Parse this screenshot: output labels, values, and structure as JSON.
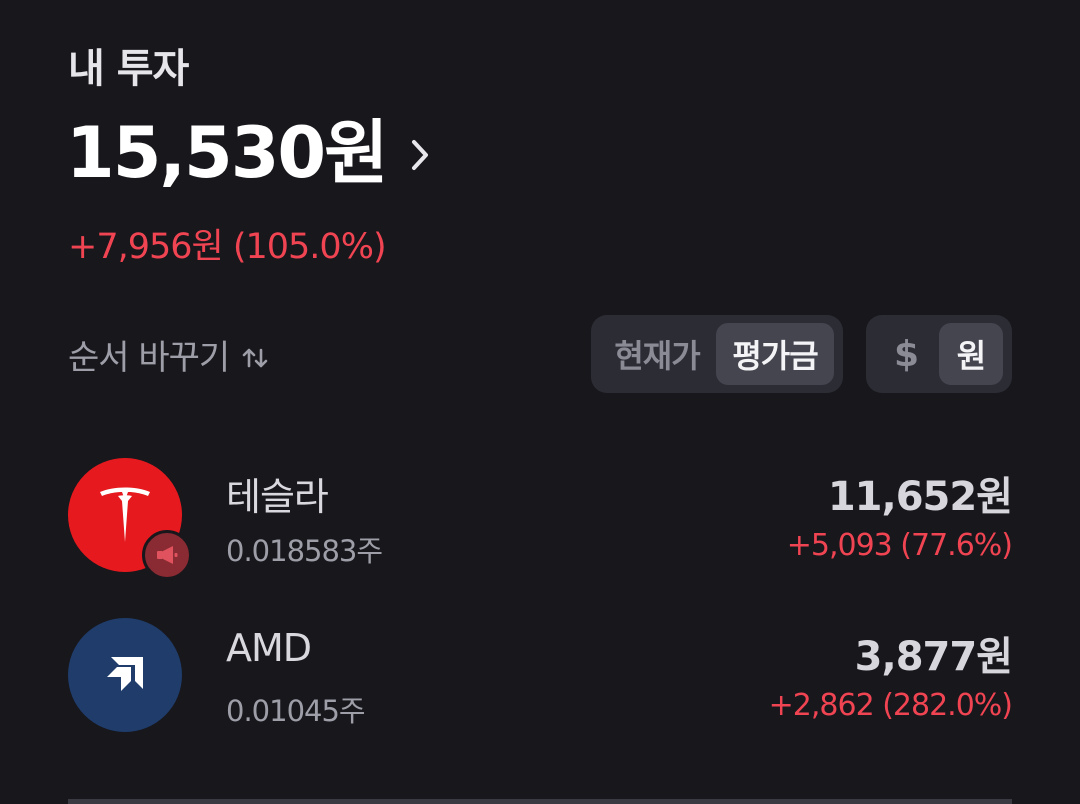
{
  "section": {
    "title": "내 투자"
  },
  "summary": {
    "total_amount": "15,530원",
    "total_change": "+7,956원 (105.0%)"
  },
  "sort": {
    "label": "순서 바꾸기",
    "icon": "sort-arrows-icon"
  },
  "view_toggle": {
    "options": [
      "현재가",
      "평가금"
    ],
    "selected": "평가금"
  },
  "currency_toggle": {
    "options": [
      "$",
      "원"
    ],
    "selected": "원"
  },
  "holdings": [
    {
      "name": "테슬라",
      "quantity": "0.018583주",
      "value": "11,652원",
      "change": "+5,093 (77.6%)",
      "logo": "tesla-logo-icon",
      "logo_color": "#e61a1e",
      "badge": "megaphone-icon"
    },
    {
      "name": "AMD",
      "quantity": "0.01045주",
      "value": "3,877원",
      "change": "+2,862 (282.0%)",
      "logo": "amd-logo-icon",
      "logo_color": "#1f3c6b"
    }
  ],
  "colors": {
    "background": "#17171c",
    "positive_change": "#f04452",
    "segment_bg": "#2c2c35",
    "segment_active": "#454550"
  }
}
